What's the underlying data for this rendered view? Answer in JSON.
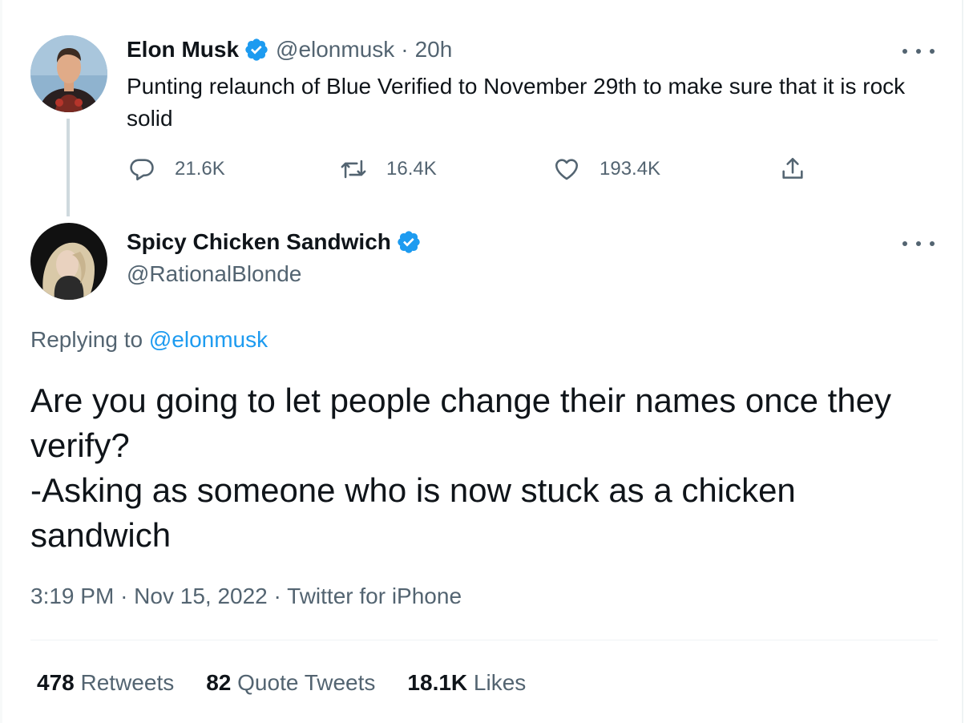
{
  "parent_tweet": {
    "author_name": "Elon Musk",
    "author_handle": "@elonmusk",
    "separator": "·",
    "time_ago": "20h",
    "text": "Punting relaunch of Blue Verified to November 29th to make sure that it is rock solid",
    "replies": "21.6K",
    "retweets": "16.4K",
    "likes": "193.4K"
  },
  "main_tweet": {
    "author_name": "Spicy Chicken Sandwich",
    "author_handle": "@RationalBlonde",
    "replying_prefix": "Replying to",
    "replying_handle": "@elonmusk",
    "text": "Are you going to let people change their names once they verify?\n-Asking as someone who is now stuck as a chicken sandwich",
    "time": "3:19 PM",
    "date": "Nov 15, 2022",
    "source": "Twitter for iPhone",
    "separator": "·",
    "retweets_count": "478",
    "retweets_label": "Retweets",
    "quotes_count": "82",
    "quotes_label": "Quote Tweets",
    "likes_count": "18.1K",
    "likes_label": "Likes"
  },
  "icons": {
    "verified": "verified-badge-icon",
    "reply": "reply-icon",
    "retweet": "retweet-icon",
    "like": "heart-icon",
    "share": "share-icon",
    "more": "more-icon"
  },
  "colors": {
    "accent": "#1d9bf0",
    "text_primary": "#0f1419",
    "text_secondary": "#536471",
    "thread_line": "#cfd9de"
  }
}
